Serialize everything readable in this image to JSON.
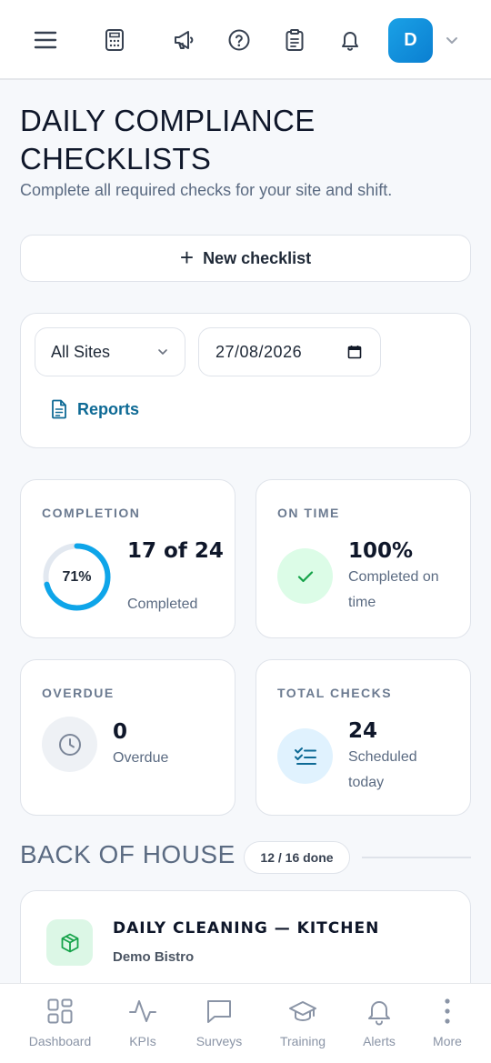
{
  "topbar": {
    "icons": [
      "menu-icon",
      "calculator-icon",
      "megaphone-icon",
      "help-icon",
      "clipboard-icon",
      "bell-icon"
    ],
    "avatar_initial": "D"
  },
  "header": {
    "title": "DAILY COMPLIANCE CHECKLISTS",
    "subtitle": "Complete all required checks for your site and shift."
  },
  "new_checklist_label": "New checklist",
  "filters": {
    "site_value": "All Sites",
    "date_value": "27/08/2026",
    "reports_label": "Reports"
  },
  "stats": {
    "completion": {
      "label": "COMPLETION",
      "percent_text": "71%",
      "percent": 0.71,
      "value": "17 of 24",
      "sub": "Completed"
    },
    "on_time": {
      "label": "ON TIME",
      "value": "100%",
      "sub": "Completed on time"
    },
    "overdue": {
      "label": "OVERDUE",
      "value": "0",
      "sub": "Overdue"
    },
    "total": {
      "label": "TOTAL CHECKS",
      "value": "24",
      "sub": "Scheduled today"
    }
  },
  "section": {
    "title": "BACK OF HOUSE",
    "badge": "12 / 16 done",
    "tasks": [
      {
        "title": "DAILY CLEANING — KITCHEN",
        "site": "Demo Bistro",
        "icon": "box-icon"
      }
    ]
  },
  "bottom_nav": [
    {
      "label": "Dashboard",
      "icon": "dashboard-icon"
    },
    {
      "label": "KPIs",
      "icon": "activity-icon"
    },
    {
      "label": "Surveys",
      "icon": "chat-icon"
    },
    {
      "label": "Training",
      "icon": "graduation-cap-icon"
    },
    {
      "label": "Alerts",
      "icon": "bell-icon"
    },
    {
      "label": "More",
      "icon": "more-vertical-icon"
    }
  ],
  "colors": {
    "accent": "#0ea5e9",
    "link": "#0e6a95",
    "success_bg": "#dcfce7",
    "success": "#16a34a",
    "info_bg": "#e0f2fe"
  }
}
